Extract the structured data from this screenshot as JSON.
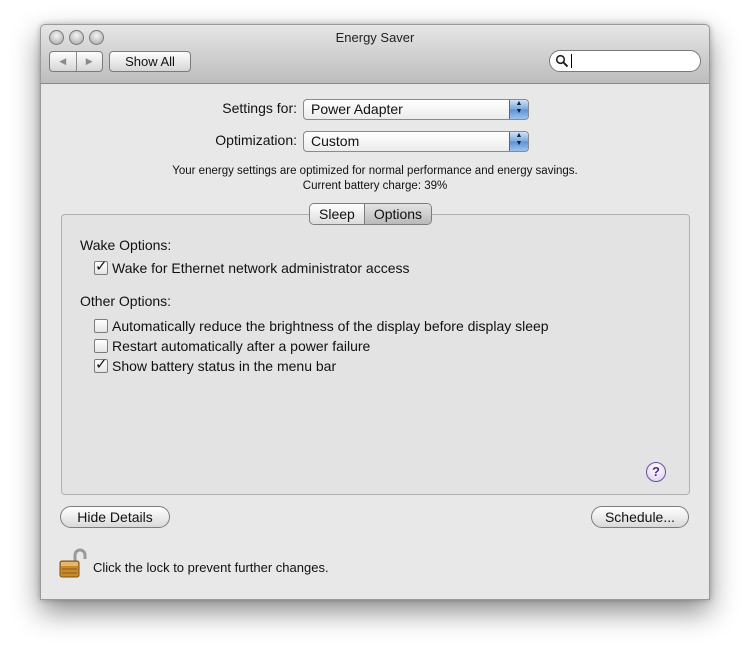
{
  "window": {
    "title": "Energy Saver"
  },
  "toolbar": {
    "back_icon": "triangle-left",
    "forward_icon": "triangle-right",
    "show_all_label": "Show All",
    "search_value": ""
  },
  "settings": {
    "settings_for_label": "Settings for:",
    "settings_for_value": "Power Adapter",
    "optimization_label": "Optimization:",
    "optimization_value": "Custom",
    "info_line1": "Your energy settings are optimized for normal performance and energy savings.",
    "info_line2": "Current battery charge: 39%"
  },
  "tabs": [
    {
      "label": "Sleep",
      "selected": false
    },
    {
      "label": "Options",
      "selected": true
    }
  ],
  "wake_options": {
    "heading": "Wake Options:",
    "items": [
      {
        "label": "Wake for Ethernet network administrator access",
        "checked": true
      }
    ]
  },
  "other_options": {
    "heading": "Other Options:",
    "items": [
      {
        "label": "Automatically reduce the brightness of the display before display sleep",
        "checked": false
      },
      {
        "label": "Restart automatically after a power failure",
        "checked": false
      },
      {
        "label": "Show battery status in the menu bar",
        "checked": true
      }
    ]
  },
  "help": {
    "label": "?"
  },
  "buttons": {
    "hide_details": "Hide Details",
    "schedule": "Schedule..."
  },
  "lock": {
    "text": "Click the lock to prevent further changes.",
    "state": "unlocked"
  },
  "colors": {
    "popup_arrow": "#5c93d4",
    "help_ring": "#6f4ea3",
    "lock_gold": "#c98a2e"
  }
}
